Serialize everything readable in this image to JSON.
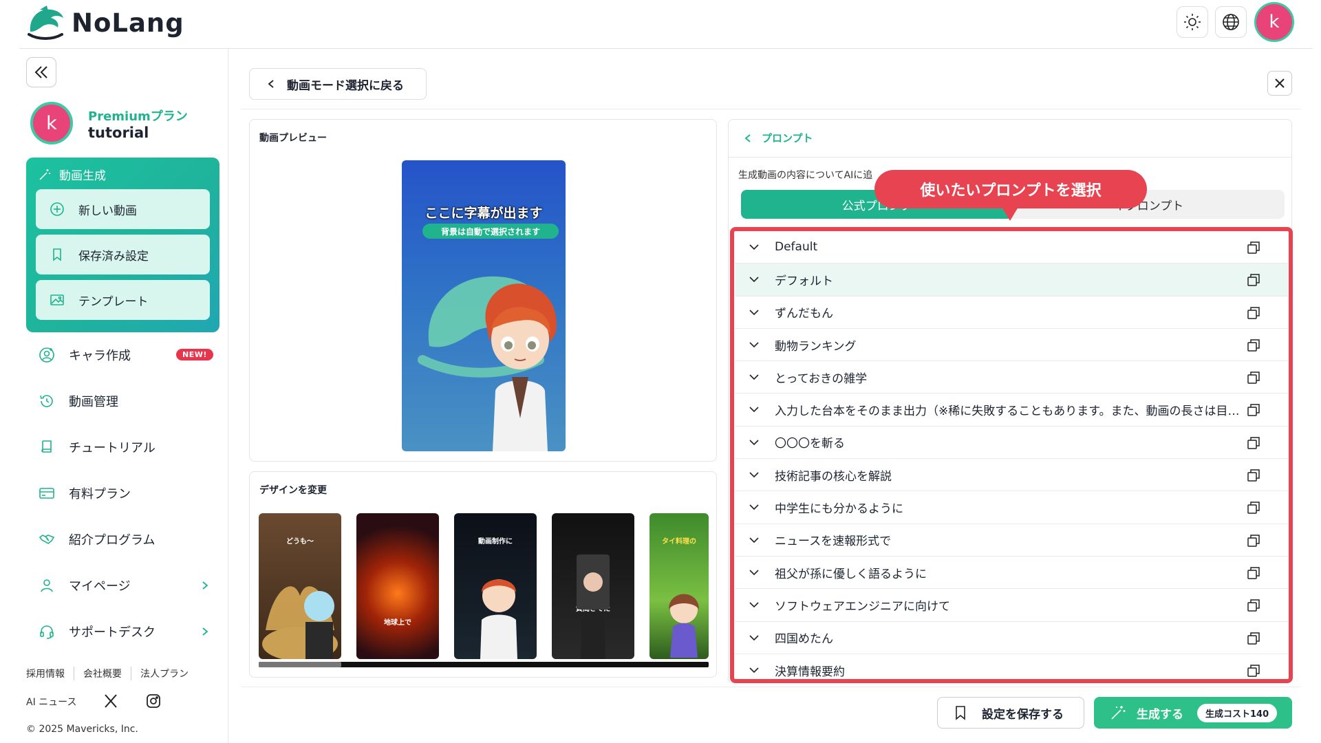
{
  "app": {
    "name": "NoLang"
  },
  "user": {
    "avatar_letter": "k",
    "plan": "Premiumプラン",
    "name": "tutorial"
  },
  "sidebar": {
    "gen_section": "動画生成",
    "gen_items": [
      {
        "label": "新しい動画",
        "icon": "plus-circle-icon"
      },
      {
        "label": "保存済み設定",
        "icon": "bookmark-icon"
      },
      {
        "label": "テンプレート",
        "icon": "image-icon"
      }
    ],
    "nav_items": [
      {
        "label": "キャラ作成",
        "icon": "character-icon"
      },
      {
        "label": "動画管理",
        "icon": "history-icon"
      },
      {
        "label": "チュートリアル",
        "icon": "book-icon"
      },
      {
        "label": "有料プラン",
        "icon": "card-icon"
      },
      {
        "label": "紹介プログラム",
        "icon": "handshake-icon"
      },
      {
        "label": "マイページ",
        "icon": "person-icon"
      },
      {
        "label": "サポートデスク",
        "icon": "headset-icon"
      }
    ],
    "new_badge": "NEW!",
    "footer_links": [
      "採用情報",
      "会社概要",
      "法人プラン"
    ],
    "ai_news": "AI ニュース",
    "copyright": "© 2025 Mavericks, Inc."
  },
  "main": {
    "back_label": "動画モード選択に戻る",
    "preview_title": "動画プレビュー",
    "subtitle_main": "ここに字幕が出ます",
    "subtitle_sub": "背景は自動で選択されます",
    "design_title": "デザインを変更",
    "thumb_captions": [
      "どうも～",
      "地球上で",
      "動画制作に",
      "質問きてた",
      "タイ料理の"
    ]
  },
  "prompt": {
    "back_label": "プロンプト",
    "description": "生成動画の内容についてAIに追",
    "tab_official": "公式プロンプ",
    "tab_mine": "イプロンプト",
    "items": [
      "Default",
      "デフォルト",
      "ずんだもん",
      "動物ランキング",
      "とっておきの雑学",
      "入力した台本をそのまま出力（※稀に失敗することもあります。また、動画の長さは目安です）",
      "〇〇〇を斬る",
      "技術記事の核心を解説",
      "中学生にも分かるように",
      "ニュースを速報形式で",
      "祖父が孫に優しく語るように",
      "ソフトウェアエンジニアに向けて",
      "四国めたん",
      "決算情報要約"
    ]
  },
  "callout": "使いたいプロンプトを選択",
  "actions": {
    "save": "設定を保存する",
    "generate": "生成する",
    "cost": "生成コスト140"
  },
  "colors": {
    "accent": "#1fb38e",
    "highlight": "#e84350",
    "badge": "#e9344e",
    "avatar": "#e8447a"
  }
}
